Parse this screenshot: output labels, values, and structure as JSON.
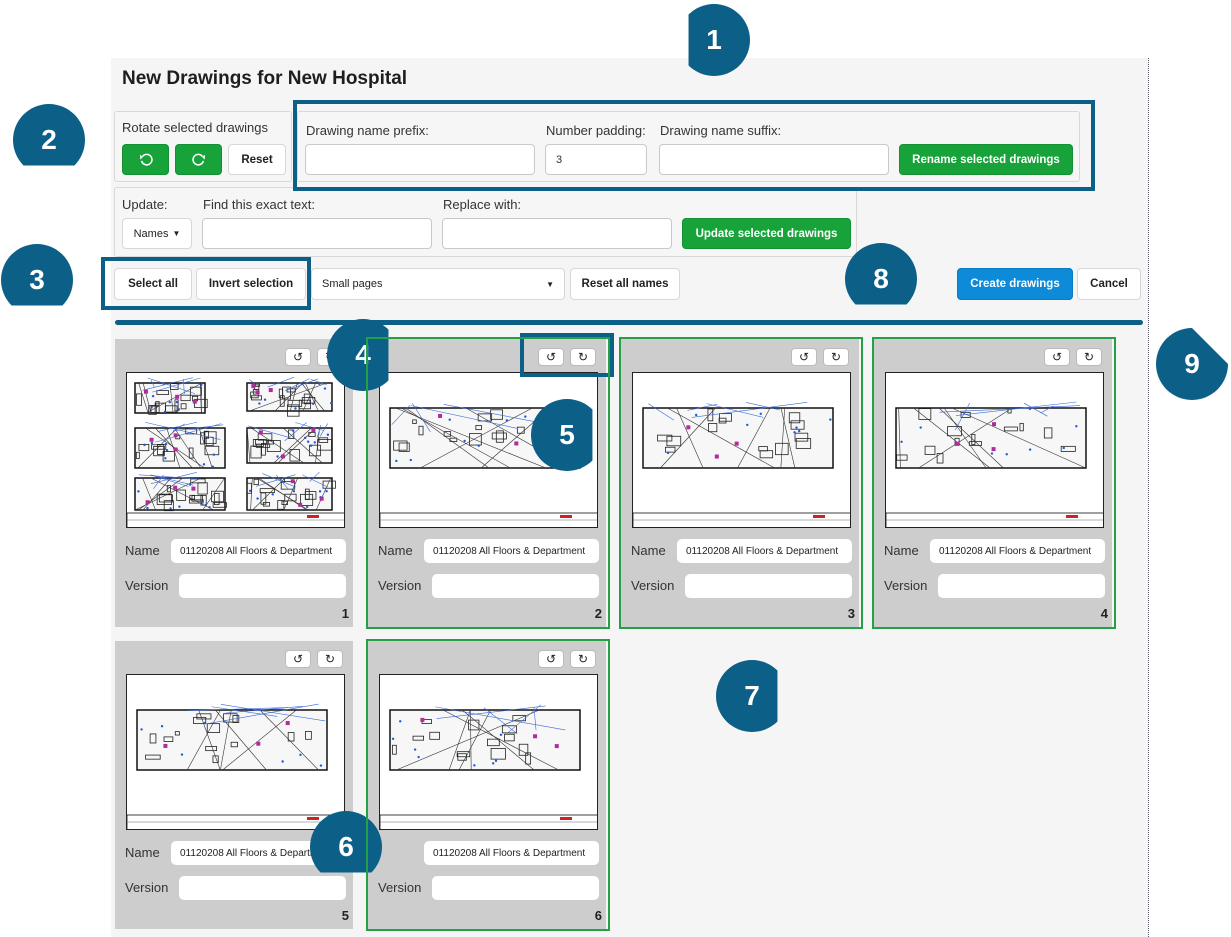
{
  "title": "New Drawings for New Hospital",
  "rotate": {
    "label": "Rotate selected drawings",
    "ccw_icon": "rotate-ccw",
    "cw_icon": "rotate-cw",
    "reset_label": "Reset"
  },
  "rename": {
    "prefix_label": "Drawing name prefix:",
    "prefix_value": "",
    "padding_label": "Number padding:",
    "padding_value": "3",
    "suffix_label": "Drawing name suffix:",
    "suffix_value": "",
    "button_label": "Rename selected drawings"
  },
  "update": {
    "label": "Update:",
    "select_value": "Names",
    "find_label": "Find this exact text:",
    "find_value": "",
    "replace_label": "Replace with:",
    "replace_value": "",
    "button_label": "Update selected drawings"
  },
  "selection": {
    "select_all": "Select all",
    "invert": "Invert selection",
    "page_size": "Small pages",
    "reset_names": "Reset all names"
  },
  "actions": {
    "create": "Create drawings",
    "cancel": "Cancel"
  },
  "cards": [
    {
      "name_label": "Name",
      "name_value": "01120208 All Floors & Department",
      "version_label": "Version",
      "version_value": "",
      "number": "1",
      "selected": false
    },
    {
      "name_label": "Name",
      "name_value": "01120208 All Floors & Department",
      "version_label": "Version",
      "version_value": "",
      "number": "2",
      "selected": true
    },
    {
      "name_label": "Name",
      "name_value": "01120208 All Floors & Department",
      "version_label": "Version",
      "version_value": "",
      "number": "3",
      "selected": true
    },
    {
      "name_label": "Name",
      "name_value": "01120208 All Floors & Department",
      "version_label": "Version",
      "version_value": "",
      "number": "4",
      "selected": true
    },
    {
      "name_label": "Name",
      "name_value": "01120208 All Floors & Departi",
      "version_label": "Version",
      "version_value": "",
      "number": "5",
      "selected": false
    },
    {
      "name_label": "",
      "name_value": "01120208 All Floors & Department",
      "version_label": "Version",
      "version_value": "",
      "number": "6",
      "selected": true
    }
  ],
  "callouts": [
    "1",
    "2",
    "3",
    "4",
    "5",
    "6",
    "7",
    "8",
    "9"
  ],
  "colors": {
    "callout": "#0c5f86",
    "green": "#17a33a",
    "blue": "#0d8ad8",
    "card_bg": "#cdcdcd"
  }
}
